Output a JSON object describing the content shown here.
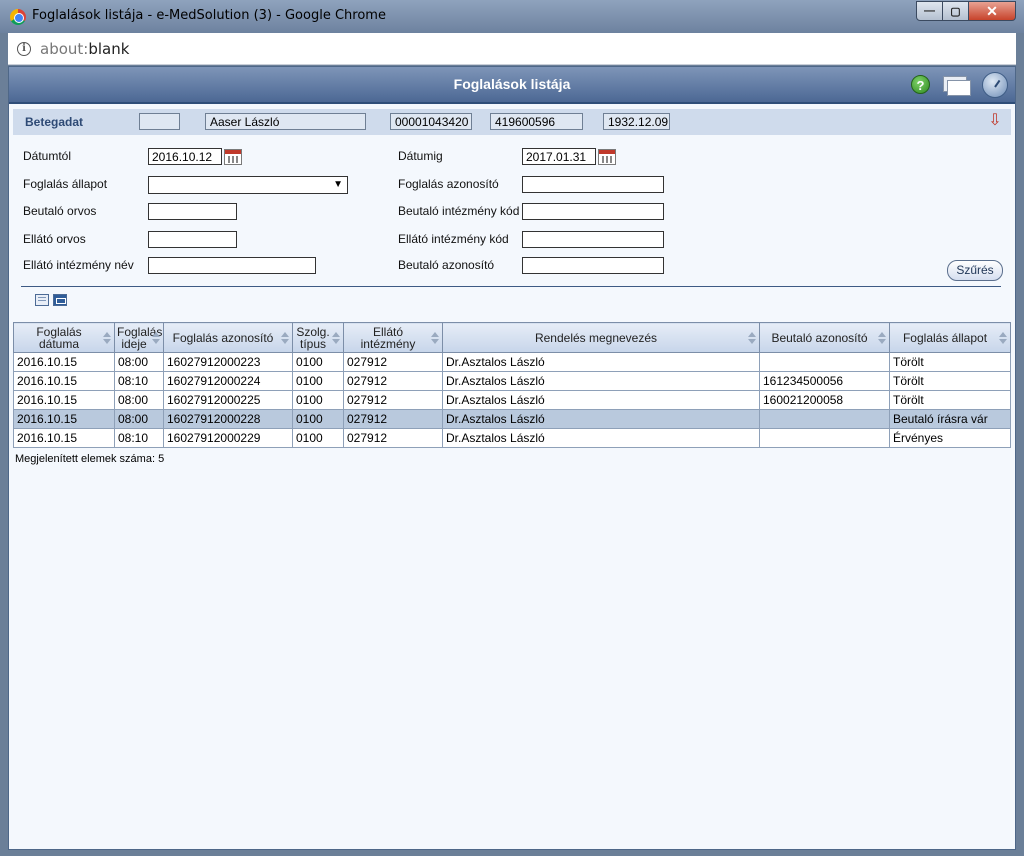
{
  "window": {
    "title": "Foglalások listája - e-MedSolution (3) - Google Chrome",
    "controls": {
      "minimize": "—",
      "maximize": "▢",
      "close": "✕"
    }
  },
  "address": {
    "scheme": "about:",
    "path": "blank"
  },
  "header": {
    "title": "Foglalások listája"
  },
  "patient": {
    "label": "Betegadat",
    "field1": "",
    "name": "Aaser László",
    "id1": "00001043420",
    "id2": "419600596",
    "birth": "1932.12.09"
  },
  "filters": {
    "date_from_label": "Dátumtól",
    "date_from": "2016.10.12",
    "date_to_label": "Dátumig",
    "date_to": "2017.01.31",
    "status_label": "Foglalás állapot",
    "status": "",
    "booking_id_label": "Foglalás azonosító",
    "booking_id": "",
    "ref_doctor_label": "Beutaló orvos",
    "ref_doctor": "",
    "ref_inst_code_label": "Beutaló intézmény kód",
    "ref_inst_code": "",
    "prov_doctor_label": "Ellátó orvos",
    "prov_doctor": "",
    "prov_inst_code_label": "Ellátó intézmény kód",
    "prov_inst_code": "",
    "prov_inst_name_label": "Ellátó intézmény név",
    "prov_inst_name": "",
    "ref_id_label": "Beutaló azonosító",
    "ref_id": "",
    "filter_button": "Szűrés"
  },
  "table": {
    "columns": [
      "Foglalás dátuma",
      "Foglalás ideje",
      "Foglalás azonosító",
      "Szolg. típus",
      "Ellátó intézmény",
      "Rendelés megnevezés",
      "Beutaló azonosító",
      "Foglalás állapot"
    ],
    "rows": [
      [
        "2016.10.15",
        "08:00",
        "16027912000223",
        "0100",
        "027912",
        "Dr.Asztalos László",
        "",
        "Törölt"
      ],
      [
        "2016.10.15",
        "08:10",
        "16027912000224",
        "0100",
        "027912",
        "Dr.Asztalos László",
        "161234500056",
        "Törölt"
      ],
      [
        "2016.10.15",
        "08:00",
        "16027912000225",
        "0100",
        "027912",
        "Dr.Asztalos László",
        "160021200058",
        "Törölt"
      ],
      [
        "2016.10.15",
        "08:00",
        "16027912000228",
        "0100",
        "027912",
        "Dr.Asztalos László",
        "",
        "Beutaló írásra vár"
      ],
      [
        "2016.10.15",
        "08:10",
        "16027912000229",
        "0100",
        "027912",
        "Dr.Asztalos László",
        "",
        "Érvényes"
      ]
    ],
    "selected_row": 3
  },
  "footer": {
    "count_text": "Megjelenített elemek száma: 5"
  }
}
